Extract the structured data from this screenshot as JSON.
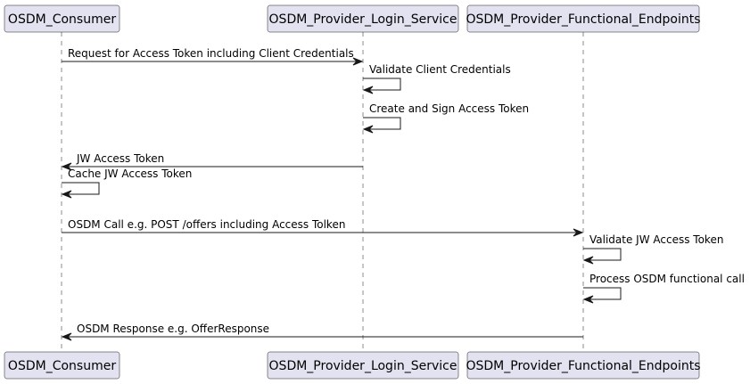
{
  "participants": [
    {
      "id": "consumer",
      "label": "OSDM_Consumer"
    },
    {
      "id": "login",
      "label": "OSDM_Provider_Login_Service"
    },
    {
      "id": "functional",
      "label": "OSDM_Provider_Functional_Endpoints"
    }
  ],
  "messages": [
    {
      "from": "consumer",
      "to": "login",
      "label": "Request for Access Token including Client Credentials"
    },
    {
      "from": "login",
      "to": "login",
      "label": "Validate Client Credentials"
    },
    {
      "from": "login",
      "to": "login",
      "label": "Create and Sign Access Token"
    },
    {
      "from": "login",
      "to": "consumer",
      "label": "JW Access Token"
    },
    {
      "from": "consumer",
      "to": "consumer",
      "label": "Cache JW Access Token"
    },
    {
      "from": "consumer",
      "to": "functional",
      "label": "OSDM Call e.g. POST /offers including Access Tolken"
    },
    {
      "from": "functional",
      "to": "functional",
      "label": "Validate JW Access Token"
    },
    {
      "from": "functional",
      "to": "functional",
      "label": "Process OSDM functional call"
    },
    {
      "from": "functional",
      "to": "consumer",
      "label": "OSDM Response e.g. OfferResponse"
    }
  ]
}
